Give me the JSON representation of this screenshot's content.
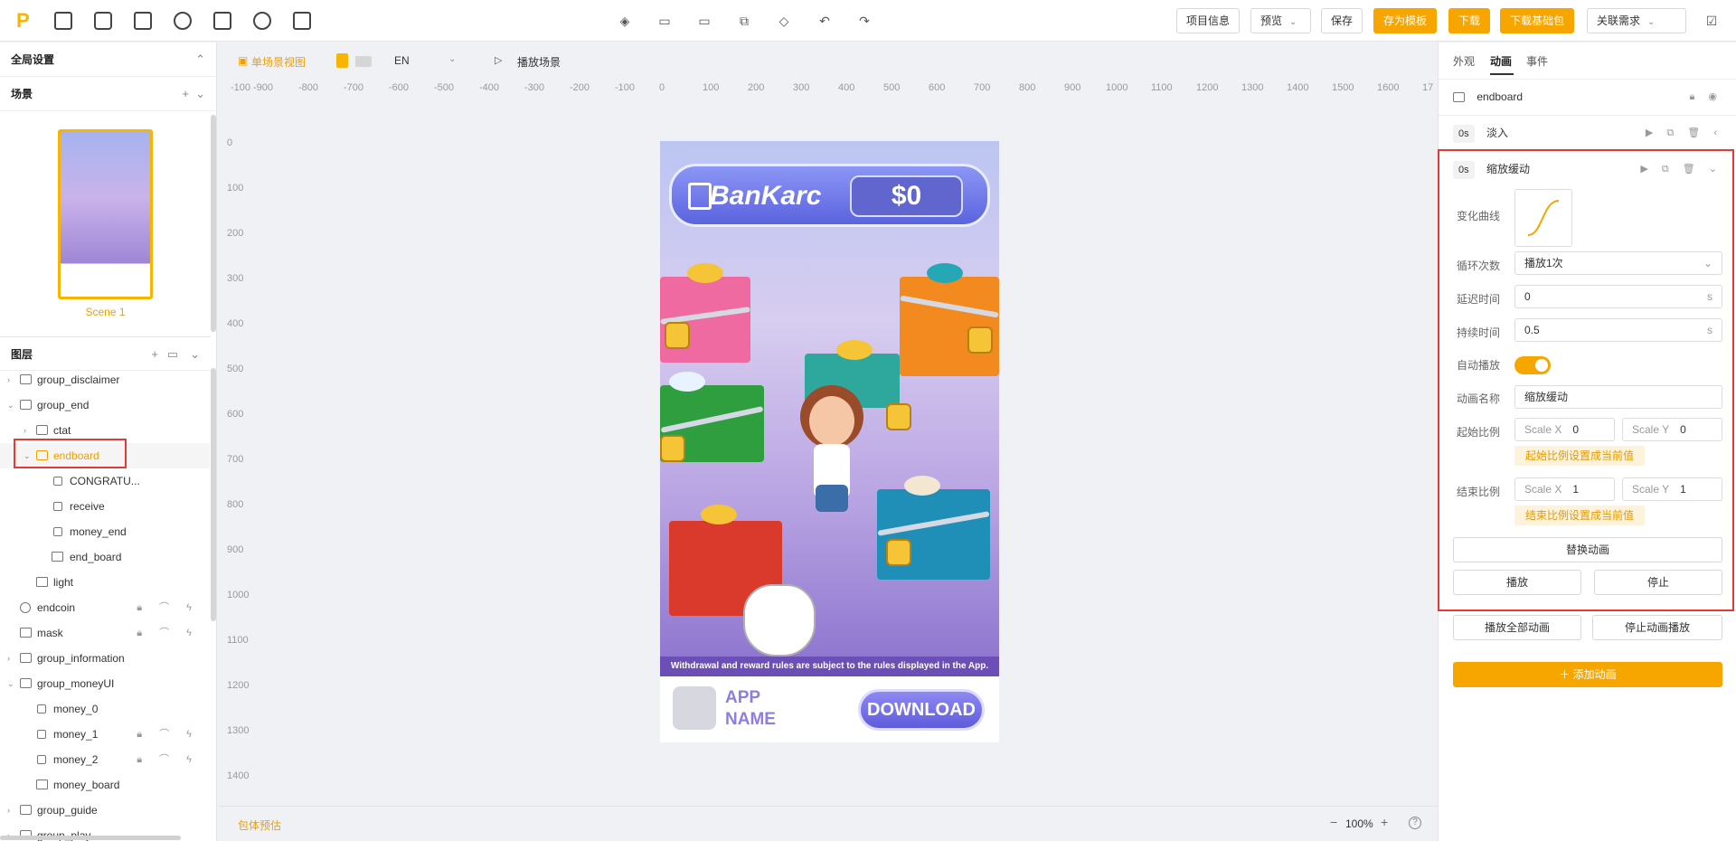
{
  "toolbar": {
    "logo": "P",
    "project_info": "项目信息",
    "preview": "预览",
    "save": "保存",
    "save_template": "存为模板",
    "download": "下载",
    "download_base": "下载基础包",
    "linked_req": "关联需求"
  },
  "left": {
    "global_settings": "全局设置",
    "scenes_title": "场景",
    "scene_name": "Scene 1",
    "layers_title": "图层",
    "layers": [
      {
        "label": "group_disclaimer"
      },
      {
        "label": "group_end"
      },
      {
        "label": "ctat"
      },
      {
        "label": "endboard"
      },
      {
        "label": "CONGRATU..."
      },
      {
        "label": "receive"
      },
      {
        "label": "money_end"
      },
      {
        "label": "end_board"
      },
      {
        "label": "light"
      },
      {
        "label": "endcoin"
      },
      {
        "label": "mask"
      },
      {
        "label": "group_information"
      },
      {
        "label": "group_moneyUI"
      },
      {
        "label": "money_0"
      },
      {
        "label": "money_1"
      },
      {
        "label": "money_2"
      },
      {
        "label": "money_board"
      },
      {
        "label": "group_guide"
      },
      {
        "label": "group_play"
      }
    ]
  },
  "canvas": {
    "view_mode": "单场景视图",
    "language": "EN",
    "play_scene": "播放场景",
    "ruler_x": [
      "-900",
      "-800",
      "-700",
      "-600",
      "-500",
      "-400",
      "-300",
      "-200",
      "-100",
      "0",
      "100",
      "200",
      "300",
      "400",
      "500",
      "600",
      "700",
      "800",
      "900",
      "1000",
      "1100",
      "1200",
      "1300",
      "1400",
      "1500",
      "1600",
      "17"
    ],
    "ruler_y_top": "-100",
    "ruler_y": [
      "0",
      "100",
      "200",
      "300",
      "400",
      "500",
      "600",
      "700",
      "800",
      "900",
      "1000",
      "1100",
      "1200",
      "1300",
      "1400"
    ],
    "ad": {
      "bank_name": "BanKarc",
      "balance": "$0",
      "disclaimer": "Withdrawal and reward rules are subject to the rules displayed in the App.",
      "app_name_1": "APP",
      "app_name_2": "NAME",
      "download_btn": "DOWNLOAD"
    },
    "package_estimate": "包体预估",
    "zoom": "100%"
  },
  "right": {
    "tabs": [
      "外观",
      "动画",
      "事件"
    ],
    "layer_name": "endboard",
    "anim1_time": "0s",
    "anim1_name": "淡入",
    "anim2_time": "0s",
    "anim2_name": "缩放缓动",
    "labels": {
      "curve": "变化曲线",
      "loop": "循环次数",
      "delay": "延迟时间",
      "duration": "持续时间",
      "autoplay": "自动播放",
      "anim_name": "动画名称",
      "start_scale": "起始比例",
      "end_scale": "结束比例"
    },
    "loop_value": "播放1次",
    "delay_value": "0",
    "duration_value": "0.5",
    "unit_s": "s",
    "autoplay_on": true,
    "anim_name_value": "缩放缓动",
    "scale_x_label": "Scale X",
    "scale_y_label": "Scale Y",
    "start_scale_x": "0",
    "start_scale_y": "0",
    "end_scale_x": "1",
    "end_scale_y": "1",
    "set_start_hint": "起始比例设置成当前值",
    "set_end_hint": "结束比例设置成当前值",
    "replace_anim": "替换动画",
    "play": "播放",
    "stop": "停止",
    "play_all": "播放全部动画",
    "stop_all": "停止动画播放",
    "add_anim": "添加动画"
  },
  "colors": {
    "accent": "#f7a600",
    "highlight": "#e53935"
  }
}
